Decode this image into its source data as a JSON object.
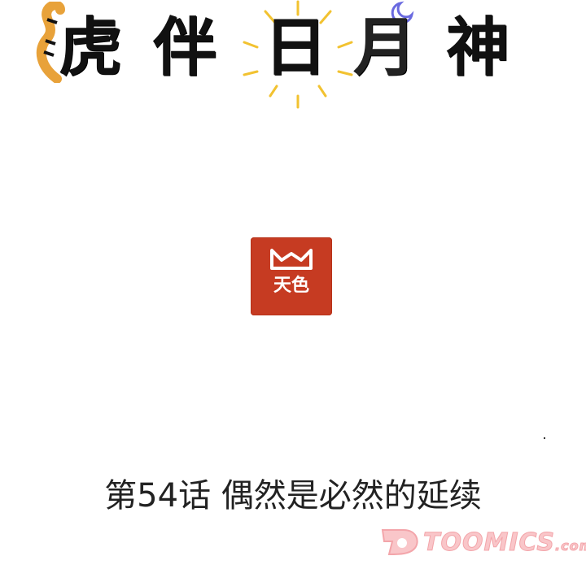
{
  "title": {
    "chars": [
      "虎",
      "伴",
      "日",
      "月",
      "神"
    ]
  },
  "seal": {
    "text": "天色",
    "color": "#c63b22"
  },
  "chapter": {
    "label": "第54话 偶然是必然的延续"
  },
  "watermark": {
    "text": "TOOMICS",
    "suffix": ".com",
    "color": "#f9c6c9"
  },
  "colors": {
    "tiger": "#e8a23a",
    "sun": "#f2c230",
    "moon": "#6a6ae0"
  }
}
